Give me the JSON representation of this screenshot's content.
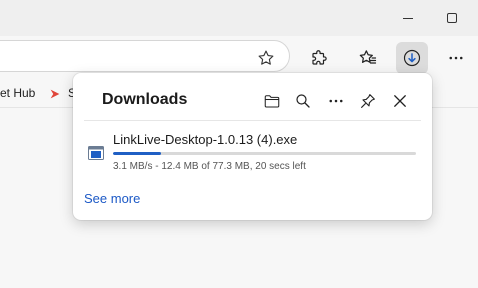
{
  "window": {
    "minimize_icon": "minimize-icon",
    "maximize_icon": "maximize-icon"
  },
  "toolbar": {
    "favorite_icon": "star-outline-icon",
    "extensions_icon": "puzzle-icon",
    "favorites_icon": "favorites-star-icon",
    "downloads_icon": "download-arrow-icon",
    "more_icon": "more-horizontal-icon"
  },
  "bookmarks": {
    "items": [
      {
        "label": "et Hub"
      },
      {
        "label": "S",
        "icon": "arrow-logo-icon"
      }
    ]
  },
  "downloads": {
    "title": "Downloads",
    "actions": [
      "folder-icon",
      "search-icon",
      "more-icon",
      "pin-icon",
      "close-icon"
    ],
    "items": [
      {
        "file_name": "LinkLive-Desktop-1.0.13 (4).exe",
        "status": "3.1 MB/s - 12.4 MB of 77.3 MB, 20 secs left",
        "progress": 0.16
      }
    ],
    "see_more": "See more"
  },
  "colors": {
    "accent": "#1f5fc4",
    "link": "#1c59c6"
  }
}
